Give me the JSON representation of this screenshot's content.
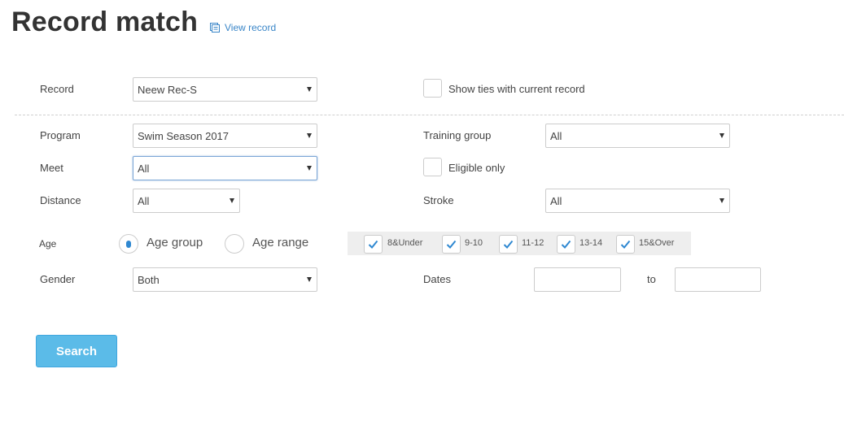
{
  "header": {
    "title": "Record match",
    "view_record_label": "View record"
  },
  "form": {
    "record": {
      "label": "Record",
      "value": "Neew Rec-S"
    },
    "show_ties": {
      "label": "Show ties with current record",
      "checked": false
    },
    "program": {
      "label": "Program",
      "value": "Swim Season 2017"
    },
    "training_group": {
      "label": "Training group",
      "value": "All"
    },
    "meet": {
      "label": "Meet",
      "value": "All"
    },
    "eligible_only": {
      "label": "Eligible only",
      "checked": false
    },
    "distance": {
      "label": "Distance",
      "value": "All"
    },
    "stroke": {
      "label": "Stroke",
      "value": "All"
    },
    "age": {
      "label": "Age",
      "age_group_label": "Age group",
      "age_range_label": "Age range",
      "selected": "Age group",
      "groups": [
        {
          "label": "8&Under",
          "checked": true
        },
        {
          "label": "9-10",
          "checked": true
        },
        {
          "label": "11-12",
          "checked": true
        },
        {
          "label": "13-14",
          "checked": true
        },
        {
          "label": "15&Over",
          "checked": true
        }
      ]
    },
    "gender": {
      "label": "Gender",
      "value": "Both"
    },
    "dates": {
      "label": "Dates",
      "from_value": "",
      "to_label": "to",
      "to_value": ""
    }
  },
  "actions": {
    "search_label": "Search"
  },
  "colors": {
    "accent": "#5bbbe8",
    "link": "#3a86c8",
    "check": "#2f88d1"
  }
}
